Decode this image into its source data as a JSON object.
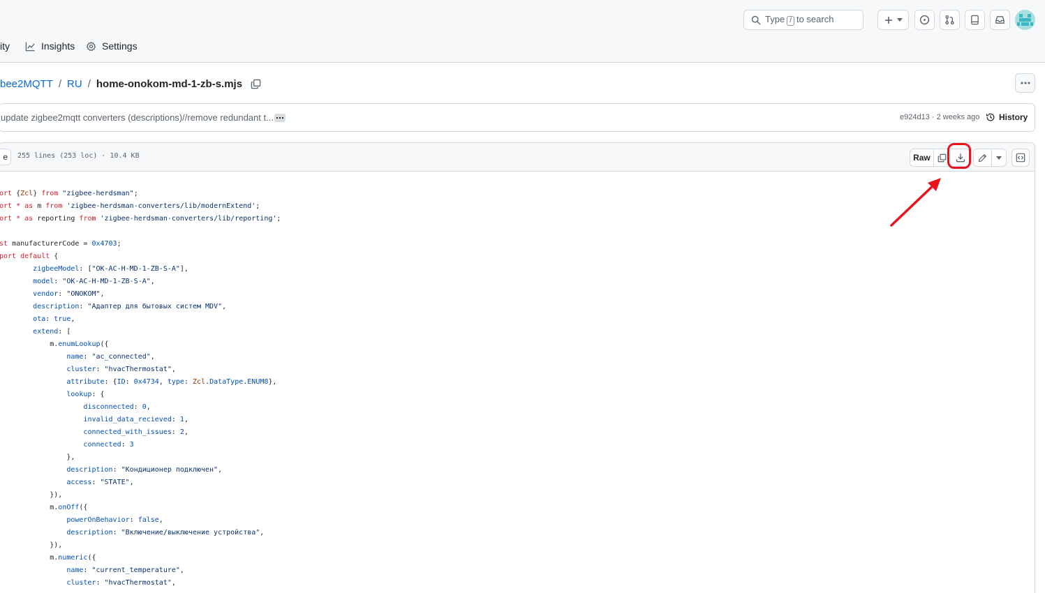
{
  "header": {
    "search": {
      "prefix": "Type",
      "key": "/",
      "suffix": "to search"
    },
    "icons": [
      "plus-icon",
      "caret-down-icon",
      "issue-icon",
      "pull-request-icon",
      "copilot-icon",
      "inbox-icon"
    ]
  },
  "repo_nav": {
    "items": [
      {
        "label": "ity",
        "icon": "shield-icon"
      },
      {
        "label": "Insights",
        "icon": "graph-icon"
      },
      {
        "label": "Settings",
        "icon": "gear-icon"
      }
    ]
  },
  "breadcrumb": {
    "parts": [
      "bee2MQTT",
      "RU"
    ],
    "file": "home-onokom-md-1-zb-s.mjs"
  },
  "commit": {
    "message": "update zigbee2mqtt converters (descriptions)//remove redundant t...",
    "sha": "e924d13",
    "time": "2 weeks ago",
    "history_label": "History"
  },
  "file_header": {
    "code_tab": "e",
    "info": "255 lines (253 loc) · 10.4 KB",
    "raw_label": "Raw"
  },
  "code_lines": [
    [
      [
        "kw",
        "ort "
      ],
      [
        "",
        "{"
      ],
      [
        "ent",
        "Zcl"
      ],
      [
        "",
        "} "
      ],
      [
        "kw",
        "from "
      ],
      [
        "str",
        "\"zigbee-herdsman\""
      ],
      [
        "",
        ";"
      ]
    ],
    [
      [
        "kw",
        "ort "
      ],
      [
        "kw",
        "* "
      ],
      [
        "kw",
        "as "
      ],
      [
        "",
        "m "
      ],
      [
        "kw",
        "from "
      ],
      [
        "str",
        "'zigbee-herdsman-converters/lib/modernExtend'"
      ],
      [
        "",
        ";"
      ]
    ],
    [
      [
        "kw",
        "ort "
      ],
      [
        "kw",
        "* "
      ],
      [
        "kw",
        "as "
      ],
      [
        "",
        "reporting "
      ],
      [
        "kw",
        "from "
      ],
      [
        "str",
        "'zigbee-herdsman-converters/lib/reporting'"
      ],
      [
        "",
        ";"
      ]
    ],
    [],
    [
      [
        "kw",
        "st "
      ],
      [
        "",
        "manufacturerCode = "
      ],
      [
        "num",
        "0x4703"
      ],
      [
        "",
        ";"
      ]
    ],
    [
      [
        "kw",
        "port default "
      ],
      [
        "",
        "{"
      ]
    ],
    [
      [
        "",
        "        "
      ],
      [
        "prop",
        "zigbeeModel"
      ],
      [
        "",
        ": ["
      ],
      [
        "str",
        "\"OK-AC-H-MD-1-ZB-S-A\""
      ],
      [
        "",
        "],"
      ]
    ],
    [
      [
        "",
        "        "
      ],
      [
        "prop",
        "model"
      ],
      [
        "",
        ": "
      ],
      [
        "str",
        "\"OK-AC-H-MD-1-ZB-S-A\""
      ],
      [
        "",
        ","
      ]
    ],
    [
      [
        "",
        "        "
      ],
      [
        "prop",
        "vendor"
      ],
      [
        "",
        ": "
      ],
      [
        "str",
        "\"ONOKOM\""
      ],
      [
        "",
        ","
      ]
    ],
    [
      [
        "",
        "        "
      ],
      [
        "prop",
        "description"
      ],
      [
        "",
        ": "
      ],
      [
        "str",
        "\"Адаптер для бытовых систем MDV\""
      ],
      [
        "",
        ","
      ]
    ],
    [
      [
        "",
        "        "
      ],
      [
        "prop",
        "ota"
      ],
      [
        "",
        ": "
      ],
      [
        "prop",
        "true"
      ],
      [
        "",
        ","
      ]
    ],
    [
      [
        "",
        "        "
      ],
      [
        "prop",
        "extend"
      ],
      [
        "",
        ": ["
      ]
    ],
    [
      [
        "",
        "            m."
      ],
      [
        "prop",
        "enumLookup"
      ],
      [
        "",
        "({"
      ]
    ],
    [
      [
        "",
        "                "
      ],
      [
        "prop",
        "name"
      ],
      [
        "",
        ": "
      ],
      [
        "str",
        "\"ac_connected\""
      ],
      [
        "",
        ","
      ]
    ],
    [
      [
        "",
        "                "
      ],
      [
        "prop",
        "cluster"
      ],
      [
        "",
        ": "
      ],
      [
        "str",
        "\"hvacThermostat\""
      ],
      [
        "",
        ","
      ]
    ],
    [
      [
        "",
        "                "
      ],
      [
        "prop",
        "attribute"
      ],
      [
        "",
        ": {"
      ],
      [
        "prop",
        "ID"
      ],
      [
        "",
        ": "
      ],
      [
        "num",
        "0x4734"
      ],
      [
        "",
        ", "
      ],
      [
        "prop",
        "type"
      ],
      [
        "",
        ": "
      ],
      [
        "ent",
        "Zcl"
      ],
      [
        "",
        "."
      ],
      [
        "prop",
        "DataType"
      ],
      [
        "",
        "."
      ],
      [
        "prop",
        "ENUM8"
      ],
      [
        "",
        "},"
      ]
    ],
    [
      [
        "",
        "                "
      ],
      [
        "prop",
        "lookup"
      ],
      [
        "",
        ": {"
      ]
    ],
    [
      [
        "",
        "                    "
      ],
      [
        "prop",
        "disconnected"
      ],
      [
        "",
        ": "
      ],
      [
        "num",
        "0"
      ],
      [
        "",
        ","
      ]
    ],
    [
      [
        "",
        "                    "
      ],
      [
        "prop",
        "invalid_data_recieved"
      ],
      [
        "",
        ": "
      ],
      [
        "num",
        "1"
      ],
      [
        "",
        ","
      ]
    ],
    [
      [
        "",
        "                    "
      ],
      [
        "prop",
        "connected_with_issues"
      ],
      [
        "",
        ": "
      ],
      [
        "num",
        "2"
      ],
      [
        "",
        ","
      ]
    ],
    [
      [
        "",
        "                    "
      ],
      [
        "prop",
        "connected"
      ],
      [
        "",
        ": "
      ],
      [
        "num",
        "3"
      ]
    ],
    [
      [
        "",
        "                },"
      ]
    ],
    [
      [
        "",
        "                "
      ],
      [
        "prop",
        "description"
      ],
      [
        "",
        ": "
      ],
      [
        "str",
        "\"Кондиционер подключен\""
      ],
      [
        "",
        ","
      ]
    ],
    [
      [
        "",
        "                "
      ],
      [
        "prop",
        "access"
      ],
      [
        "",
        ": "
      ],
      [
        "str",
        "\"STATE\""
      ],
      [
        "",
        ","
      ]
    ],
    [
      [
        "",
        "            }),"
      ]
    ],
    [
      [
        "",
        "            m."
      ],
      [
        "prop",
        "onOff"
      ],
      [
        "",
        "({"
      ]
    ],
    [
      [
        "",
        "                "
      ],
      [
        "prop",
        "powerOnBehavior"
      ],
      [
        "",
        ": "
      ],
      [
        "prop",
        "false"
      ],
      [
        "",
        ","
      ]
    ],
    [
      [
        "",
        "                "
      ],
      [
        "prop",
        "description"
      ],
      [
        "",
        ": "
      ],
      [
        "str",
        "\"Включение/выключение устройства\""
      ],
      [
        "",
        ","
      ]
    ],
    [
      [
        "",
        "            }),"
      ]
    ],
    [
      [
        "",
        "            m."
      ],
      [
        "prop",
        "numeric"
      ],
      [
        "",
        "({"
      ]
    ],
    [
      [
        "",
        "                "
      ],
      [
        "prop",
        "name"
      ],
      [
        "",
        ": "
      ],
      [
        "str",
        "\"current_temperature\""
      ],
      [
        "",
        ","
      ]
    ],
    [
      [
        "",
        "                "
      ],
      [
        "prop",
        "cluster"
      ],
      [
        "",
        ": "
      ],
      [
        "str",
        "\"hvacThermostat\""
      ],
      [
        "",
        ","
      ]
    ]
  ],
  "colors": {
    "annotation": "#e8131b",
    "link": "#0969da",
    "keyword": "#cf222e",
    "string": "#0a3069",
    "property": "#0550ae"
  }
}
